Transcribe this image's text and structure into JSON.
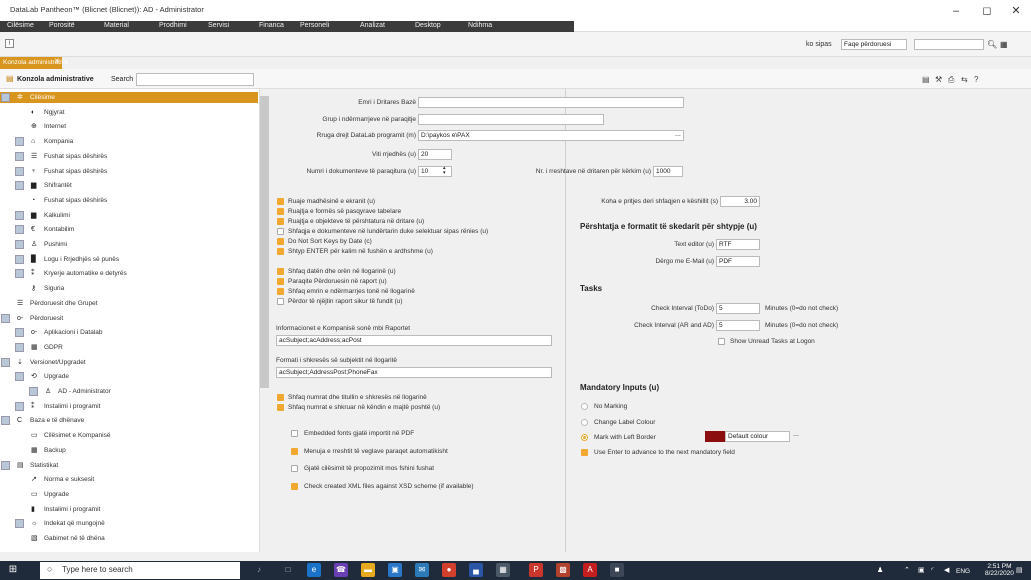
{
  "window": {
    "title": "DataLab Pantheon™ (Blicnet (Blicnet)): AD - Administrator",
    "minimize": "–",
    "maximize": "◻",
    "close": "✕"
  },
  "menu": [
    "Cilësime",
    "Porositë",
    "Material",
    "Prodhimi",
    "Servisi",
    "Financa",
    "Personeli",
    "Analizat",
    "Desktop",
    "Ndihma"
  ],
  "toolbar": {
    "sort_label": "ko sipas",
    "sort_value": "Faqe përdoruesi",
    "search_icon": "search-icon",
    "grid_icon": "grid-icon"
  },
  "tab": {
    "label": "Konzola administrative",
    "close": "✕"
  },
  "console": {
    "title": "Konzola administrative",
    "search_label": "Search"
  },
  "tree": [
    {
      "label": "Cilësime",
      "icon": "✲",
      "level": 0,
      "expander": true,
      "selected": true
    },
    {
      "label": "Ngjyrat",
      "icon": "◐",
      "level": 1
    },
    {
      "label": "Internet",
      "icon": "⊕",
      "level": 1
    },
    {
      "label": "Kompania",
      "icon": "⌂",
      "level": 1,
      "expander": true
    },
    {
      "label": "Fushat sipas dëshirës",
      "icon": "☰",
      "level": 1,
      "expander": true
    },
    {
      "label": "Fushat sipas dëshirës",
      "icon": "♆",
      "level": 1,
      "expander": true
    },
    {
      "label": "Shifrantët",
      "icon": "▆",
      "level": 1,
      "expander": true
    },
    {
      "label": "Fushat sipas dëshirës",
      "icon": "◔",
      "level": 1
    },
    {
      "label": "Kalkulimi",
      "icon": "▆",
      "level": 1,
      "expander": true
    },
    {
      "label": "Kontabilim",
      "icon": "€",
      "level": 1,
      "expander": true
    },
    {
      "label": "Pushimi",
      "icon": "♙",
      "level": 1,
      "expander": true
    },
    {
      "label": "Logu i Rrjedhjës së punës",
      "icon": "▉",
      "level": 1,
      "expander": true
    },
    {
      "label": "Kryerje automatike e detyrës",
      "icon": "⁑",
      "level": 1,
      "expander": true
    },
    {
      "label": "Siguria",
      "icon": "⚷",
      "level": 1
    },
    {
      "label": "Përdoruesit dhe Grupet",
      "icon": "☰",
      "level": 0
    },
    {
      "label": "Përdoruesit",
      "icon": "o-",
      "level": 0,
      "expander": true
    },
    {
      "label": "Aplikacioni i Datalab",
      "icon": "o-",
      "level": 1,
      "expander": true
    },
    {
      "label": "GDPR",
      "icon": "▦",
      "level": 1,
      "expander": true
    },
    {
      "label": "Versionet/Upgradet",
      "icon": "⇣",
      "level": 0,
      "expander": true
    },
    {
      "label": "Upgrade",
      "icon": "⟲",
      "level": 1,
      "expander": true
    },
    {
      "label": "AD - Administrator",
      "icon": "♙",
      "level": 2,
      "expander": true
    },
    {
      "label": "Instalimi i programit",
      "icon": "⁑",
      "level": 1,
      "expander": true
    },
    {
      "label": "Baza e të dhënave",
      "icon": "C",
      "level": 0,
      "expander": true
    },
    {
      "label": "Cilësimet e Kompanisë",
      "icon": "▭",
      "level": 1
    },
    {
      "label": "Backup",
      "icon": "▦",
      "level": 1
    },
    {
      "label": "Statistikat",
      "icon": "▤",
      "level": 0,
      "expander": true
    },
    {
      "label": "Norma e suksesit",
      "icon": "↗",
      "level": 1
    },
    {
      "label": "Upgrade",
      "icon": "▭",
      "level": 1
    },
    {
      "label": "Instalimi i programit",
      "icon": "▮",
      "level": 1
    },
    {
      "label": "Indekat që mungojnë",
      "icon": "☼",
      "level": 1,
      "expander": true
    },
    {
      "label": "Gabimet në të dhëna",
      "icon": "▧",
      "level": 1
    }
  ],
  "form": {
    "emri_label": "Emri i Dritares Bazë",
    "grup_label": "Grup i ndërmarrjeve në paraqitje",
    "rruga_label": "Rruga drejt DataLab programit (m)",
    "rruga_value": "D:\\paykos e\\PAX",
    "rruga_btn": "...",
    "viti_label": "Viti rrjedhës (u)",
    "viti_value": "20",
    "numri_label": "Numri i dokumenteve të paraqitura (u)",
    "numri_value": "10",
    "nr_label": "Nr. i rreshtave në dritaren për kërkim (u)",
    "nr_value": "1000",
    "koha_label": "Koha e pritjes deri shfaqjen e këshillit (s)",
    "koha_value": "3.00",
    "checkboxes": [
      {
        "label": "Ruaje madhësinë e ekranit (u)",
        "on": true
      },
      {
        "label": "Ruajtja e formës së pasqyrave tabelare",
        "on": true
      },
      {
        "label": "Ruajtja e objekteve të përshtatura në dritare (u)",
        "on": true
      },
      {
        "label": "Shfaqja e dokumenteve në lundërtarin duke selektuar sipas rënies (u)",
        "on": false
      },
      {
        "label": "Do Not Sort Keys by Date (c)",
        "on": true
      },
      {
        "label": "Shtyp ENTER për kalim në fushën e ardhshme (u)",
        "on": true
      },
      {
        "label": "Shfaq datën dhe orën në llogarinë (u)",
        "on": true
      },
      {
        "label": "Paraqite Përdoruesin në raport (u)",
        "on": true
      },
      {
        "label": "Shfaq emrin e ndërmarrjes tonë në llogarinë",
        "on": true
      },
      {
        "label": "Përdor të njëjtin raport sikur të fundit (u)",
        "on": false
      }
    ],
    "info_label": "Informacionet e Kompanisë sonë mbi Raportet",
    "info_value": "acSubject;acAddress;acPost",
    "format_label": "Formati i shkresës së subjektit në llogaritë",
    "format_value": "acSubject;AddressPost;PhoneFax",
    "checkboxes2": [
      {
        "label": "Shfaq numrat dhe titullin e shkresës në llogarinë",
        "on": true
      },
      {
        "label": "Shfaq numrat e shkruar në këndin e majtë poshtë (u)",
        "on": true
      }
    ],
    "embedded_label": "Embedded fonts gjatë importit në PDF",
    "menuja_label": "Menuja e rreshtit të veglave paraqet automatikisht",
    "gjate_label": "Gjatë cilësimit të propozimit mos fshini fushat",
    "check_label": "Check created XML files against XSD scheme (if available)"
  },
  "right": {
    "format_heading": "Përshtatja e formatit të skedarit për shtypje (u)",
    "text_editor_label": "Text editor (u)",
    "text_editor_value": "RTF",
    "email_label": "Dërgo me E-Mail (u)",
    "email_value": "PDF",
    "tasks_heading": "Tasks",
    "check_todo_label": "Check Interval (ToDo)",
    "check_todo_value": "5",
    "check_ar_label": "Check Interval (AR and AD)",
    "check_ar_value": "5",
    "minutes_label": "Minutes (0=do not check)",
    "unread_label": "Show Unread Tasks at Logon",
    "mandatory_heading": "Mandatory Inputs (u)",
    "radio": [
      "No Marking",
      "Change Label Colour",
      "Mark with Left Border"
    ],
    "default_colour": "Default colour",
    "default_colour_btn": "...",
    "enter_label": "Use Enter to advance to the next mandatory field",
    "border_color": "#8b0d0d"
  },
  "taskbar": {
    "search": "Type here to search",
    "lang": "ENG",
    "time": "2:51 PM",
    "date": "8/22/2020"
  },
  "colors": {
    "accent": "#d9961e",
    "menu_bg": "#3b3b3b",
    "taskbar": "#1f2a3a"
  }
}
